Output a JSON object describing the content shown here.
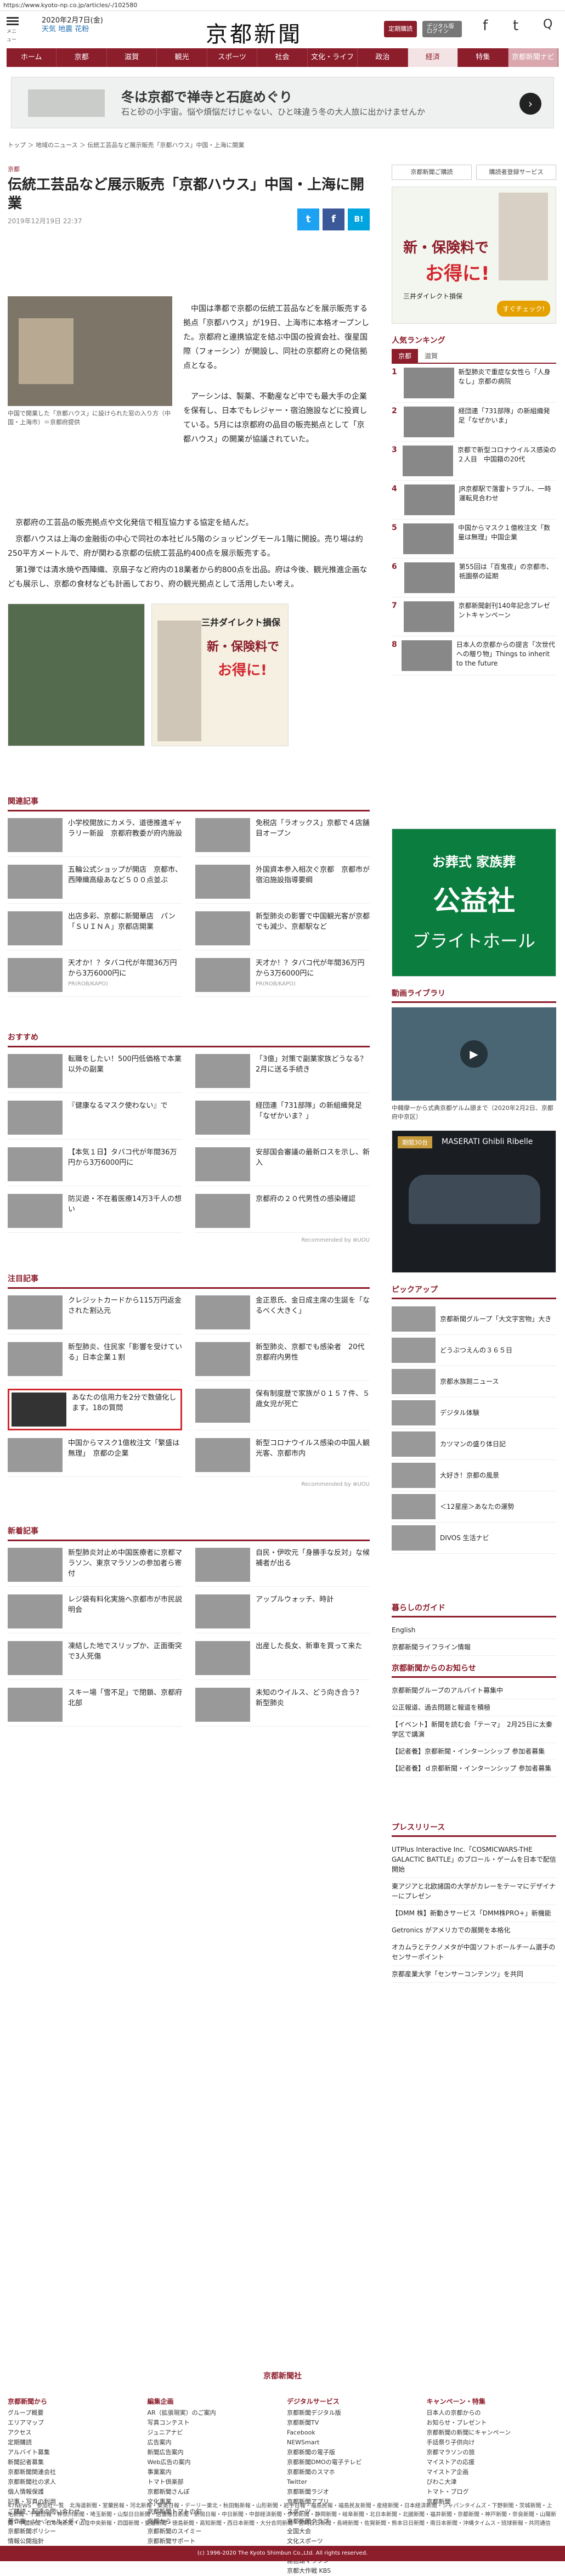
{
  "url": "https://www.kyoto-np.co.jp/articles/-/102580",
  "header": {
    "menu_label": "メニュー",
    "date": "2020年2月7日(金)",
    "weather": "天気  地震  花粉",
    "logo": "京都新聞",
    "btn_subscribe": "定期購読",
    "btn_digital": "デジタル版ログイン",
    "social": [
      "f",
      "t",
      "Q"
    ],
    "social_labels": [
      "Facebook",
      "Twitter",
      "検索"
    ]
  },
  "nav": [
    "ホーム",
    "京都",
    "滋賀",
    "観光",
    "スポーツ",
    "社会",
    "文化・ライフ",
    "政治",
    "経済",
    "特集",
    "京都新聞ナビ"
  ],
  "top_ad": {
    "title": "冬は京都で禅寺と石庭めぐり",
    "sub": "石と砂の小宇宙。悩や煩悩だけじゃない、ひと味違う冬の大人旅に出かけませんか"
  },
  "breadcrumb": "トップ ＞ 地域のニュース ＞ 伝統工芸品など展示販売「京都ハウス」中国・上海に開業",
  "article": {
    "category": "京都",
    "headline": "伝統工芸品など展示販売「京都ハウス」中国・上海に開業",
    "date": "2019年12月19日 22:37",
    "share": [
      "t",
      "f",
      "B!"
    ],
    "caption": "中国で開業した「京都ハウス」に設けられた窓の入り方（中国・上海市）＝京都府提供",
    "body1": "中国は準都で京都の伝統工芸品などを展示販売する拠点「京都ハウス」が19日、上海市に本格オープンした。京都府と連携協定を結ぶ中国の投資会社、復星国際（フォーシン）が開設し、同社の京都府との発信拠点となる。",
    "body2a": "アーシンは、製薬、不動産など中でも最大手の企業を保有し、日本でもレジャー・宿泊施設などに投資している。5月には京都府の品目の販売拠点として「京都ハウス」の開業が協議されていた。",
    "body2b": "京都府の工芸品の販売拠点や文化発信で相互協力する協定を結んだ。",
    "body2c": "京都ハウスは上海の金融街の中心で同社の本社ビル5階のショッピングモール1階に開設。売り場は約250平方メートルで、府が関わる京都の伝統工芸品約400点を展示販売する。",
    "body2d": "第1弾では清水焼や西陣織、京扇子など府内の18業者から約800点を出品。府は今後、観光推進企画なども展示し、京都の食材なども計画しており、府の観光拠点として活用したい考え。"
  },
  "sections": {
    "related": {
      "title": "関連記事",
      "items": [
        "小学校開放にカメラ、道徳推進ギャラリー新設　京都府教委が府内施設",
        "免税店「ラオックス」京都で４店舗目オープン",
        "五輪公式ショップが開店　京都市、西陣織高級あなど５００点並ぶ",
        "外国資本参入相次ぐ京都　京都市が宿泊施設指導要綱",
        "出店多彩、京都に新聞華店　パン「ＳＵＩＮＡ」京都店開業",
        "新型肺炎の影響で中国観光客が京都でも減少、京都駅など",
        "天才か！？タバコ代が年間36万円から3万6000円に",
        "天才か！？タバコ代が年間36万円から3万6000円に"
      ],
      "pr": "PR(ROB/KAPO)"
    },
    "recommend": {
      "title": "おすすめ",
      "items": [
        "転職をしたい！500円低価格で本業以外の副業",
        "「3億」対策で副業家族どうなる？　2月に送る手続き",
        "『健康なるマスク使わない』で",
        "経団連「731部隊」の新組織発足「なぜかいま？」",
        "【本気１日】タバコ代が年間36万円から3万6000円に",
        "安部国会審議の最新ロスを示し、新入",
        "防災遊・不在着医療14万3千人の想い",
        "京都府の２０代男性の感染確認"
      ],
      "credit": "Recommended by ⊕UOU"
    },
    "attention": {
      "title": "注目記事",
      "items": [
        "クレジットカードから115万円返金された割込元",
        "金正恩氏、金日成主席の生誕を「なるべく大きく」",
        "新型肺炎、住民家「影響を受けている」日本企業１割",
        "新型肺炎、京都でも感染者　20代京都府内男性",
        "あなたの信用力を2分で数値化します。18の質問",
        "保有制度歴で家族が０１５７件、５歳女児が死亡",
        "中国からマスク1億枚注文「繁盛は無理」　京都の企業",
        "新型コロナウイルス感染の中国人観光客、京都市内"
      ],
      "credit": "Recommended by ⊕UOU"
    },
    "latest": {
      "title": "新着記事",
      "items": [
        "新型肺炎対止め中国医療者に京都マラソン、東京マラソンの参加者ら寄付",
        "自民・伊吹元「身勝手な反対」な候補者が出る",
        "レジ袋有料化実施へ京都市が市民説明会",
        "アップルウォッチ、時計",
        "凍結した地でスリップか、正面衝突で3人死傷",
        "出産した長女、新車を買って来た",
        "スキー場「雪不足」で閉鎖、京都府北部",
        "未知のウイルス、どう向き合う？　新型肺炎"
      ]
    }
  },
  "side": {
    "btn1": "京都新聞ご購読",
    "btn2": "購読者登録サービス",
    "ad1": {
      "title": "新・保険料で",
      "title2": "お得に!",
      "brand": "三井ダイレクト損保",
      "cta": "すぐチェック!"
    },
    "ranking": {
      "title": "人気ランキング",
      "tabs": [
        "京都",
        "滋賀"
      ],
      "items": [
        "新型肺炎で重症な女性ら「人身なし」京都の病院",
        "経団連「731部隊」の新組織発足「なぜかいま」",
        "京都で新型コロナウイルス感染の２人目　中国籍の20代",
        "JR京都駅で落雷トラブル、一時運転見合わせ",
        "中国からマスク１億枚注文「数量は無理」中国企業",
        "第55回は「百鬼夜」の京都市、祇園祭の延期",
        "京都新聞創刊140年記念プレゼントキャンペーン",
        "日本人の京都からの提言「次世代への贈り物」Things to inherit to the future"
      ]
    },
    "funeral_ad": [
      "お葬式 家族葬",
      "公益社",
      "ブライトホール"
    ],
    "video": {
      "title": "動画ライブラリ",
      "caption": "中韓摩一から式典京都ゲルム頭まで（2020年2月2日、京都府中京区）"
    },
    "car_ad": {
      "title": "MASERATI Ghibli Ribelle",
      "label": "期間30台"
    },
    "pickup": {
      "title": "ピックアップ",
      "items": [
        "京都新聞グループ「大文字宮物」大き",
        "どうぶつえんの３６５日",
        "京都水族館ニュース",
        "デジタル体験",
        "カツマンの盛り体日記",
        "大好き！京都の風景",
        "＜12星座＞あなたの運勢",
        "DIVOS 生活ナビ"
      ]
    },
    "guide": {
      "title": "暮らしのガイド",
      "items": [
        "English",
        "京都新聞ライフライン情報"
      ]
    },
    "notice": {
      "title": "京都新聞からのお知らせ",
      "items": [
        "京都新聞グループのアルバイト募集中",
        "公正報道、過去問題と報道を積極",
        "【イベント】新聞を読む会「テーマ」　2月25日に太秦学区で講演",
        "【記者養】京都新聞・インターンシップ 参加者募集",
        "【記者養】ｄ京都新聞・インターンシップ 参加者募集"
      ]
    },
    "press": {
      "title": "プレスリリース",
      "items": [
        "UTPlus Interactive Inc.「COSMICWARS-THE GALACTIC BATTLE」のブロール・ゲームを日本で配信開始",
        "東アジアと北欧諸国の大学がカレーをテーマにデザイナーにプレゼン",
        "【DMM 株】新動きサービス「DMM株PRO+」新機能",
        "Getronics がアメリカでの展開を本格化",
        "オカムラとテクノメタが中国ソフトボールチーム選手のセンサーポイント",
        "京都産業大学「センサーコンテンツ」を共同"
      ]
    }
  },
  "footer": {
    "logo": "京都新聞社",
    "cols": [
      {
        "h": "京都新聞から",
        "items": [
          "グループ概要",
          "エリアマップ",
          "アクセス",
          "定期購読",
          "アルバイト募集",
          "新聞記者募集",
          "京都新聞関連会社",
          "京都新聞社の求人",
          "個人情報保護",
          "記事・写真の利用",
          "ご購読・配達の問い合わせ",
          "著作権・ソーシャルメディア",
          "京都新聞ポリシー",
          "情報公開指針",
          "サイトポリシー"
        ]
      },
      {
        "h": "編集企画",
        "items": [
          "AR（拡張現実）のご案内",
          "写真コンテスト",
          "ジュニアナビ",
          "広告案内",
          "新聞広告案内",
          "Web広告の案内",
          "事業案内",
          "トマト倶楽部",
          "京都新聞さんぽ",
          "文化事業",
          "京都新聞トマトの旬",
          "京都から",
          "京都新聞のスイミー",
          "京都新聞サポート"
        ]
      },
      {
        "h": "デジタルサービス",
        "items": [
          "京都新聞デジタル版",
          "京都新聞TV",
          "Facebook",
          "NEWSmart",
          "京都新聞の電子版",
          "京都新聞DMOの電子テレビ",
          "京都新聞のスマホ",
          "Twitter",
          "京都新聞ラジオ",
          "京都新聞アプリ",
          "スポーツ",
          "京都新聞クラブ",
          "全国大会",
          "文化スポーツ",
          "京都新聞杯",
          "琵琶湖マラソン",
          "京都大作戦 KBS"
        ]
      },
      {
        "h": "キャンペーン・特集",
        "items": [
          "日本人の京都からの",
          "お知らせ・プレゼント",
          "京都新聞の新聞にキャンペーン",
          "手話祭り子供向け",
          "京都マラソンの旅",
          "マイストアの応援",
          "マイストア企画",
          "びわこ大津",
          "トマト・ブログ",
          "京都新聞"
        ]
      }
    ]
  },
  "news47": "47NEWS　参加社一覧　北海道新聞・室蘭民報・河北新報・東奥日報・デーリー東北・秋田魁新報・山形新聞・岩手日報・福島民報・福島民友新聞・産経新聞・日本経済新聞・ジャパンタイムズ・下野新聞・茨城新聞・上毛新聞・千葉日報・神奈川新聞・埼玉新聞・山梨日日新聞・信濃毎日新聞・新潟日報・中日新聞・中部経済新聞・伊勢新聞・静岡新聞・岐阜新聞・北日本新聞・北國新聞・福井新聞・京都新聞・神戸新聞・奈良新聞・山陽新聞・中国新聞・日本海新聞・山陰中央新報・四国新聞・愛媛新聞・徳島新聞・高知新聞・西日本新聞・大分合同新聞・宮崎日日新聞・長崎新聞・佐賀新聞・熊本日日新聞・南日本新聞・沖縄タイムス・琉球新報・共同通信",
  "copyright": "(c) 1996-2020 The Kyoto Shimbun Co.,Ltd. All rights reserved.",
  "colors": {
    "brand": "#8c1d2b",
    "twitter": "#1da1f2",
    "facebook": "#3b5998",
    "hatena": "#00a4de"
  }
}
